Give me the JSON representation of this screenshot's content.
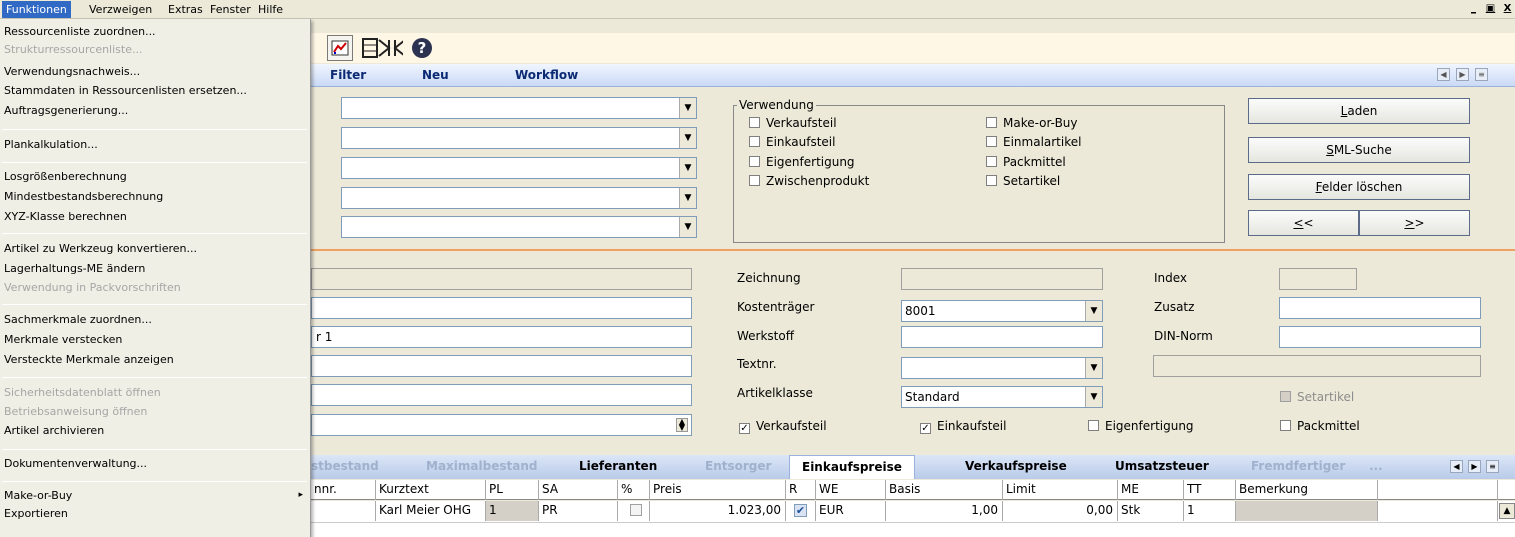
{
  "menubar": {
    "items": [
      "Funktionen",
      "Verzweigen",
      "Extras",
      "Fenster",
      "Hilfe"
    ],
    "window_controls": [
      "_",
      "т",
      "X"
    ]
  },
  "menu": {
    "items": [
      {
        "label": "Ressourcenliste zuordnen...",
        "enabled": true
      },
      {
        "label": "Strukturressourcenliste...",
        "enabled": false
      },
      {
        "label": "Verwendungsnachweis...",
        "enabled": true
      },
      {
        "label": "Stammdaten in Ressourcenlisten ersetzen...",
        "enabled": true
      },
      {
        "label": "Auftragsgenerierung...",
        "enabled": true
      },
      {
        "label": "Plankalkulation...",
        "enabled": true
      },
      {
        "label": "Losgrößenberechnung",
        "enabled": true
      },
      {
        "label": "Mindestbestandsberechnung",
        "enabled": true
      },
      {
        "label": "XYZ-Klasse berechnen",
        "enabled": true
      },
      {
        "label": "Artikel zu Werkzeug konvertieren...",
        "enabled": true
      },
      {
        "label": "Lagerhaltungs-ME ändern",
        "enabled": true
      },
      {
        "label": "Verwendung in Packvorschriften",
        "enabled": false
      },
      {
        "label": "Sachmerkmale zuordnen...",
        "enabled": true
      },
      {
        "label": "Merkmale verstecken",
        "enabled": true
      },
      {
        "label": "Versteckte Merkmale anzeigen",
        "enabled": true
      },
      {
        "label": "Sicherheitsdatenblatt öffnen",
        "enabled": false
      },
      {
        "label": "Betriebsanweisung öffnen",
        "enabled": false
      },
      {
        "label": "Artikel archivieren",
        "enabled": true
      },
      {
        "label": "Dokumentenverwaltung...",
        "enabled": true
      },
      {
        "label": "Make-or-Buy",
        "enabled": true,
        "submenu": "▸"
      },
      {
        "label": "Exportieren",
        "enabled": true
      }
    ]
  },
  "toolbar": {
    "icons": [
      "chart-icon",
      "film-icon",
      "merge-icon",
      "help-icon"
    ]
  },
  "band": {
    "filter": "Filter",
    "neu": "Neu",
    "workflow": "Workflow"
  },
  "search": {
    "verwendung_title": "Verwendung",
    "checks": [
      "Verkaufsteil",
      "Einkaufsteil",
      "Eigenfertigung",
      "Zwischenprodukt",
      "Make-or-Buy",
      "Einmalartikel",
      "Packmittel",
      "Setartikel"
    ],
    "laden": "Laden",
    "sml": "SML-Suche",
    "felder": "Felder löschen",
    "prev": "<<",
    "next": ">>"
  },
  "detail": {
    "left_fragment": "r 1",
    "zeichnung": "Zeichnung",
    "kostentraeger": "Kostenträger",
    "kostentraeger_value": "8001",
    "werkstoff": "Werkstoff",
    "textnr": "Textnr.",
    "artikelklasse": "Artikelklasse",
    "artikelklasse_value": "Standard",
    "index": "Index",
    "zusatz": "Zusatz",
    "din": "DIN-Norm",
    "cb_verkaufsteil": "Verkaufsteil",
    "cb_einkaufsteil": "Einkaufsteil",
    "cb_eigenfertigung": "Eigenfertigung",
    "cb_setartikel": "Setartikel",
    "cb_packmittel": "Packmittel"
  },
  "tabs": [
    "stbestand",
    "Maximalbestand",
    "Lieferanten",
    "Entsorger",
    "Einkaufspreise",
    "Verkaufspreise",
    "Umsatzsteuer",
    "Fremdfertiger",
    "..."
  ],
  "table": {
    "headers": [
      "nnr.",
      "Kurztext",
      "PL",
      "SA",
      "%",
      "Preis",
      "R",
      "WE",
      "Basis",
      "Limit",
      "ME",
      "TT",
      "Bemerkung"
    ],
    "row": [
      "",
      "Karl Meier OHG",
      "1",
      "PR",
      "",
      "1.023,00",
      "✔",
      "EUR",
      "1,00",
      "0,00",
      "Stk",
      "1",
      ""
    ]
  }
}
